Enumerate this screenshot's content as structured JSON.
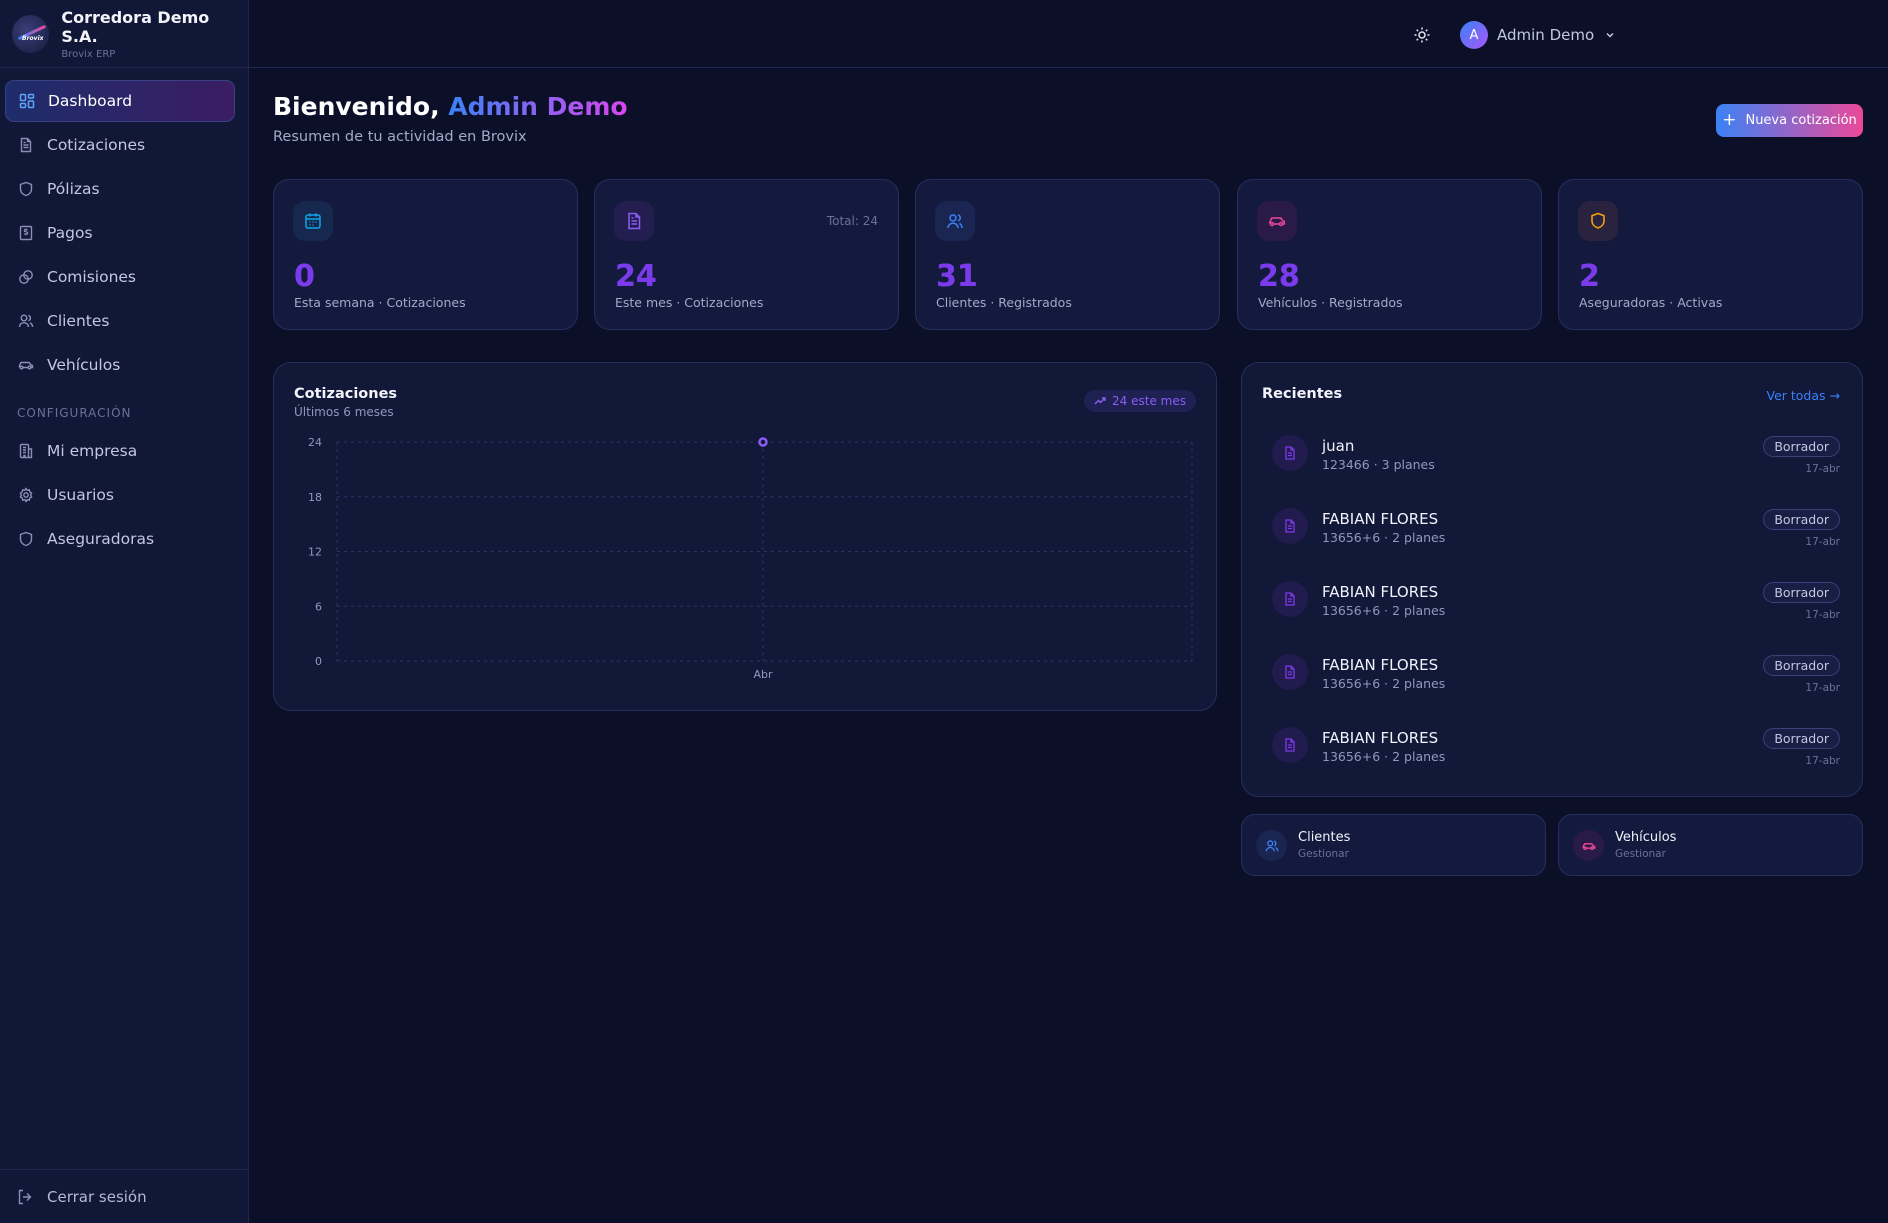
{
  "brand": {
    "name": "Corredora Demo S.A.",
    "subtitle": "Brovix ERP",
    "logo_text": "Brovix"
  },
  "sidebar": {
    "items": [
      {
        "label": "Dashboard",
        "icon": "dashboard-icon",
        "active": true
      },
      {
        "label": "Cotizaciones",
        "icon": "document-icon"
      },
      {
        "label": "Pólizas",
        "icon": "shield-icon"
      },
      {
        "label": "Pagos",
        "icon": "receipt-icon"
      },
      {
        "label": "Comisiones",
        "icon": "coins-icon"
      },
      {
        "label": "Clientes",
        "icon": "users-icon"
      },
      {
        "label": "Vehículos",
        "icon": "car-icon"
      }
    ],
    "section_label": "CONFIGURACIÓN",
    "config_items": [
      {
        "label": "Mi empresa",
        "icon": "building-icon"
      },
      {
        "label": "Usuarios",
        "icon": "gear-icon"
      },
      {
        "label": "Aseguradoras",
        "icon": "shield-icon"
      }
    ],
    "logout_label": "Cerrar sesión"
  },
  "topbar": {
    "user_initial": "A",
    "user_name": "Admin Demo"
  },
  "header": {
    "greeting": "Bienvenido,",
    "user": "Admin Demo",
    "subtitle": "Resumen de tu actividad en Brovix",
    "new_button": "Nueva cotización"
  },
  "stats": [
    {
      "value": "0",
      "label": "Esta semana · Cotizaciones",
      "icon": "calendar-icon",
      "color": "#0ea5e9"
    },
    {
      "value": "24",
      "label": "Este mes · Cotizaciones",
      "icon": "document-icon",
      "color": "#8b5cf6",
      "total": "Total: 24"
    },
    {
      "value": "31",
      "label": "Clientes · Registrados",
      "icon": "users-icon",
      "color": "#3b82f6"
    },
    {
      "value": "28",
      "label": "Vehículos · Registrados",
      "icon": "car-icon",
      "color": "#ec4899"
    },
    {
      "value": "2",
      "label": "Aseguradoras · Activas",
      "icon": "shield-icon",
      "color": "#f59e0b"
    }
  ],
  "chart_panel": {
    "title": "Cotizaciones",
    "subtitle": "Últimos 6 meses",
    "pill": "24 este mes"
  },
  "chart_data": {
    "type": "line",
    "categories": [
      "Abr"
    ],
    "values": [
      24
    ],
    "ylim": [
      0,
      24
    ],
    "yticks": [
      "24",
      "18",
      "12",
      "6",
      "0"
    ],
    "grid": true,
    "color": "#8b5cf6"
  },
  "recent": {
    "title": "Recientes",
    "link": "Ver todas",
    "items": [
      {
        "name": "juan",
        "meta": "123466 · 3 planes",
        "status": "Borrador",
        "date": "17-abr"
      },
      {
        "name": "FABIAN FLORES",
        "meta": "13656+6 · 2 planes",
        "status": "Borrador",
        "date": "17-abr"
      },
      {
        "name": "FABIAN FLORES",
        "meta": "13656+6 · 2 planes",
        "status": "Borrador",
        "date": "17-abr"
      },
      {
        "name": "FABIAN FLORES",
        "meta": "13656+6 · 2 planes",
        "status": "Borrador",
        "date": "17-abr"
      },
      {
        "name": "FABIAN FLORES",
        "meta": "13656+6 · 2 planes",
        "status": "Borrador",
        "date": "17-abr"
      }
    ]
  },
  "quick": [
    {
      "title": "Clientes",
      "sub": "Gestionar",
      "icon": "users-icon",
      "color": "#3b82f6"
    },
    {
      "title": "Vehículos",
      "sub": "Gestionar",
      "icon": "car-icon",
      "color": "#ec4899"
    }
  ]
}
